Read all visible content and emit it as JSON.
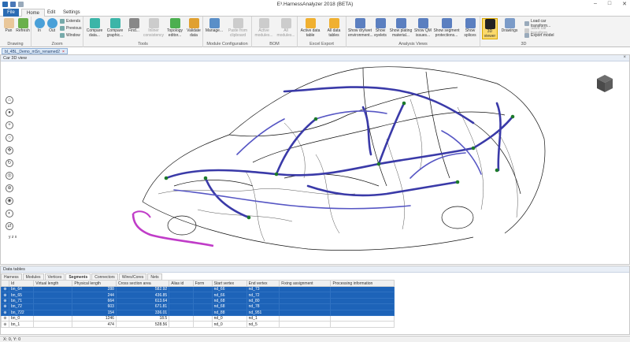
{
  "app": {
    "title": "E³.HarnessAnalyzer 2018 (BETA)",
    "window_controls": [
      "–",
      "□",
      "✕"
    ]
  },
  "tabs": [
    "File",
    "Home",
    "Edit",
    "Settings"
  ],
  "ribbon": {
    "drawing": {
      "label": "Drawing",
      "pan": "Pan",
      "refresh": "Refresh"
    },
    "zoom": {
      "label": "Zoom",
      "in": "In",
      "out": "Out",
      "extends": "Extends",
      "previous": "Previous",
      "window": "Window"
    },
    "tools": {
      "label": "Tools",
      "compare_data": "Compare data...",
      "compare_graphic": "Compare graphic...",
      "find": "Find...",
      "inliner": "Inliner consistency",
      "topology": "Topology editor...",
      "validate": "Validate data"
    },
    "module_config": {
      "label": "Module Configuration",
      "manage": "Manage...",
      "paste": "Paste from clipboard"
    },
    "bom": {
      "label": "BOM",
      "active_modules": "Active modules...",
      "all_modules": "All modules..."
    },
    "excel": {
      "label": "Excel Export",
      "active_table": "Active data table",
      "all_tables": "All data tables"
    },
    "analysis": {
      "label": "Analysis Views",
      "dry_wet": "Show dry/wet environment...",
      "eyelets": "Show eyelets",
      "plating": "Show plating material...",
      "qm": "Show QM issues...",
      "segment_prot": "Show segment protections...",
      "splices": "Show splices"
    },
    "threed": {
      "label": "3D",
      "viewer": "3D viewer",
      "drawings": "Drawings",
      "load": "Load car transform...",
      "save": "Save car transform...",
      "export": "Export model"
    }
  },
  "document_tab": "bl_4BL_Demo_mSn_renamed2",
  "view": {
    "title": "Car 3D view",
    "axes": "y  z  x"
  },
  "data_tables": {
    "title": "Data tables",
    "tabs": [
      "Harness",
      "Modules",
      "Vertices",
      "Segments",
      "Connectors",
      "Wires/Cores",
      "Nets"
    ],
    "active_tab": "Segments",
    "columns": [
      "Id",
      "Virtual length",
      "Physical length",
      "Cross section area",
      "Alias id",
      "Form",
      "Start vertex",
      "End vertex",
      "Fixing assignment",
      "Processing information"
    ],
    "rows": [
      {
        "id": "bn_64",
        "virtual": "",
        "physical": "288",
        "cross": "582.92",
        "alias": "",
        "form": "",
        "start": "nd_66",
        "end": "nd_73",
        "fixing": "",
        "proc": "",
        "selected": true
      },
      {
        "id": "bn_65",
        "virtual": "",
        "physical": "244",
        "cross": "436.85",
        "alias": "",
        "form": "",
        "start": "nd_66",
        "end": "nd_72",
        "fixing": "",
        "proc": "",
        "selected": true
      },
      {
        "id": "bn_71",
        "virtual": "",
        "physical": "664",
        "cross": "613.64",
        "alias": "",
        "form": "",
        "start": "nd_68",
        "end": "nd_80",
        "fixing": "",
        "proc": "",
        "selected": true
      },
      {
        "id": "bn_72",
        "virtual": "",
        "physical": "603",
        "cross": "671.81",
        "alias": "",
        "form": "",
        "start": "nd_68",
        "end": "nd_78",
        "fixing": "",
        "proc": "",
        "selected": true
      },
      {
        "id": "bn_722",
        "virtual": "",
        "physical": "154",
        "cross": "336.01",
        "alias": "",
        "form": "",
        "start": "nd_88",
        "end": "nd_951",
        "fixing": "",
        "proc": "",
        "selected": true
      },
      {
        "id": "bn_0",
        "virtual": "",
        "physical": "1246",
        "cross": "18.5",
        "alias": "",
        "form": "",
        "start": "nd_0",
        "end": "nd_1",
        "fixing": "",
        "proc": "",
        "selected": false
      },
      {
        "id": "bn_1",
        "virtual": "",
        "physical": "474",
        "cross": "528.56",
        "alias": "",
        "form": "",
        "start": "nd_0",
        "end": "nd_5",
        "fixing": "",
        "proc": "",
        "selected": false
      }
    ]
  },
  "status": "X: 0, Y: 0",
  "colors": {
    "accent": "#2b6cb3",
    "selection": "#1d63b8",
    "harness": "#3a3aa8",
    "highlight": "#c03cc8"
  }
}
